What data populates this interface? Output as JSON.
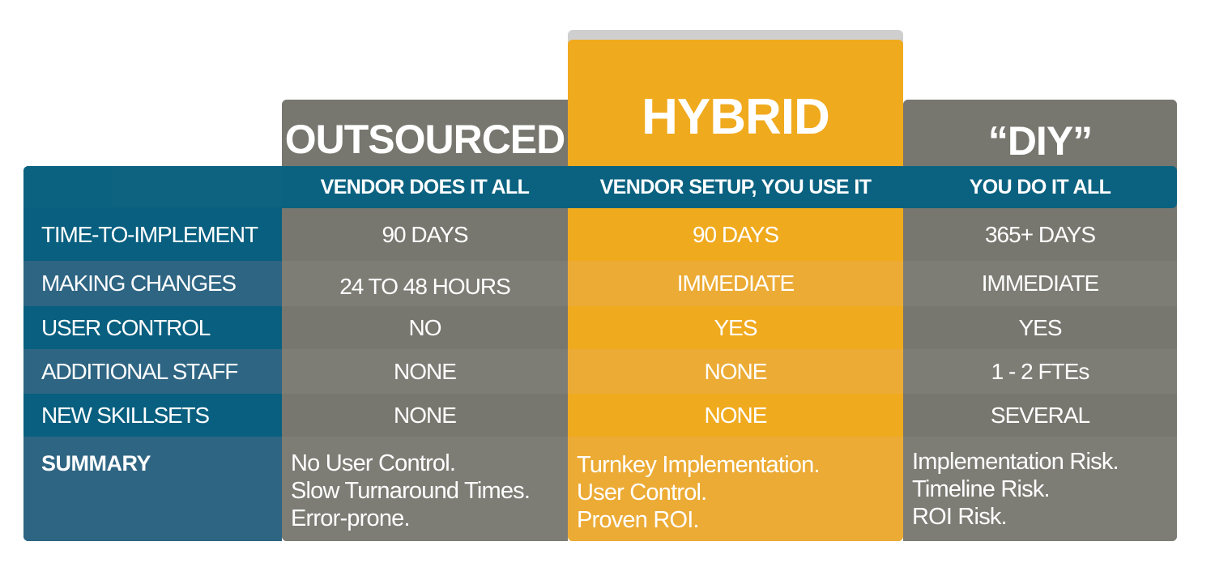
{
  "row_labels": [
    "TIME-TO-IMPLEMENT",
    "MAKING CHANGES",
    "USER CONTROL",
    "ADDITIONAL STAFF",
    "NEW SKILLSETS",
    "SUMMARY"
  ],
  "columns": [
    {
      "title": "OUTSOURCED",
      "subtitle": "VENDOR DOES IT ALL",
      "values": [
        "90 DAYS",
        "24 TO 48 HOURS",
        "NO",
        "NONE",
        "NONE"
      ],
      "summary": [
        "No User Control.",
        "Slow Turnaround Times.",
        "Error-prone."
      ]
    },
    {
      "title": "HYBRID",
      "subtitle": "VENDOR SETUP, YOU USE IT",
      "values": [
        "90 DAYS",
        "IMMEDIATE",
        "YES",
        "NONE",
        "NONE"
      ],
      "summary": [
        "Turnkey Implementation.",
        "User Control.",
        "Proven ROI."
      ]
    },
    {
      "title": "“DIY”",
      "subtitle": "YOU DO IT ALL",
      "values": [
        "365+ DAYS",
        "IMMEDIATE",
        "YES",
        "1 - 2 FTEs",
        "SEVERAL"
      ],
      "summary": [
        "Implementation Risk.",
        "Timeline Risk.",
        "ROI Risk."
      ]
    }
  ],
  "colors": {
    "blue": "#0a6180",
    "blue_alt": "#2e6583",
    "grey": "#77776f",
    "grey_alt": "#7d7d76",
    "orange": "#f0aa1e",
    "orange_alt": "#ecab35",
    "highlight_shadow": "#d0cfcf"
  }
}
